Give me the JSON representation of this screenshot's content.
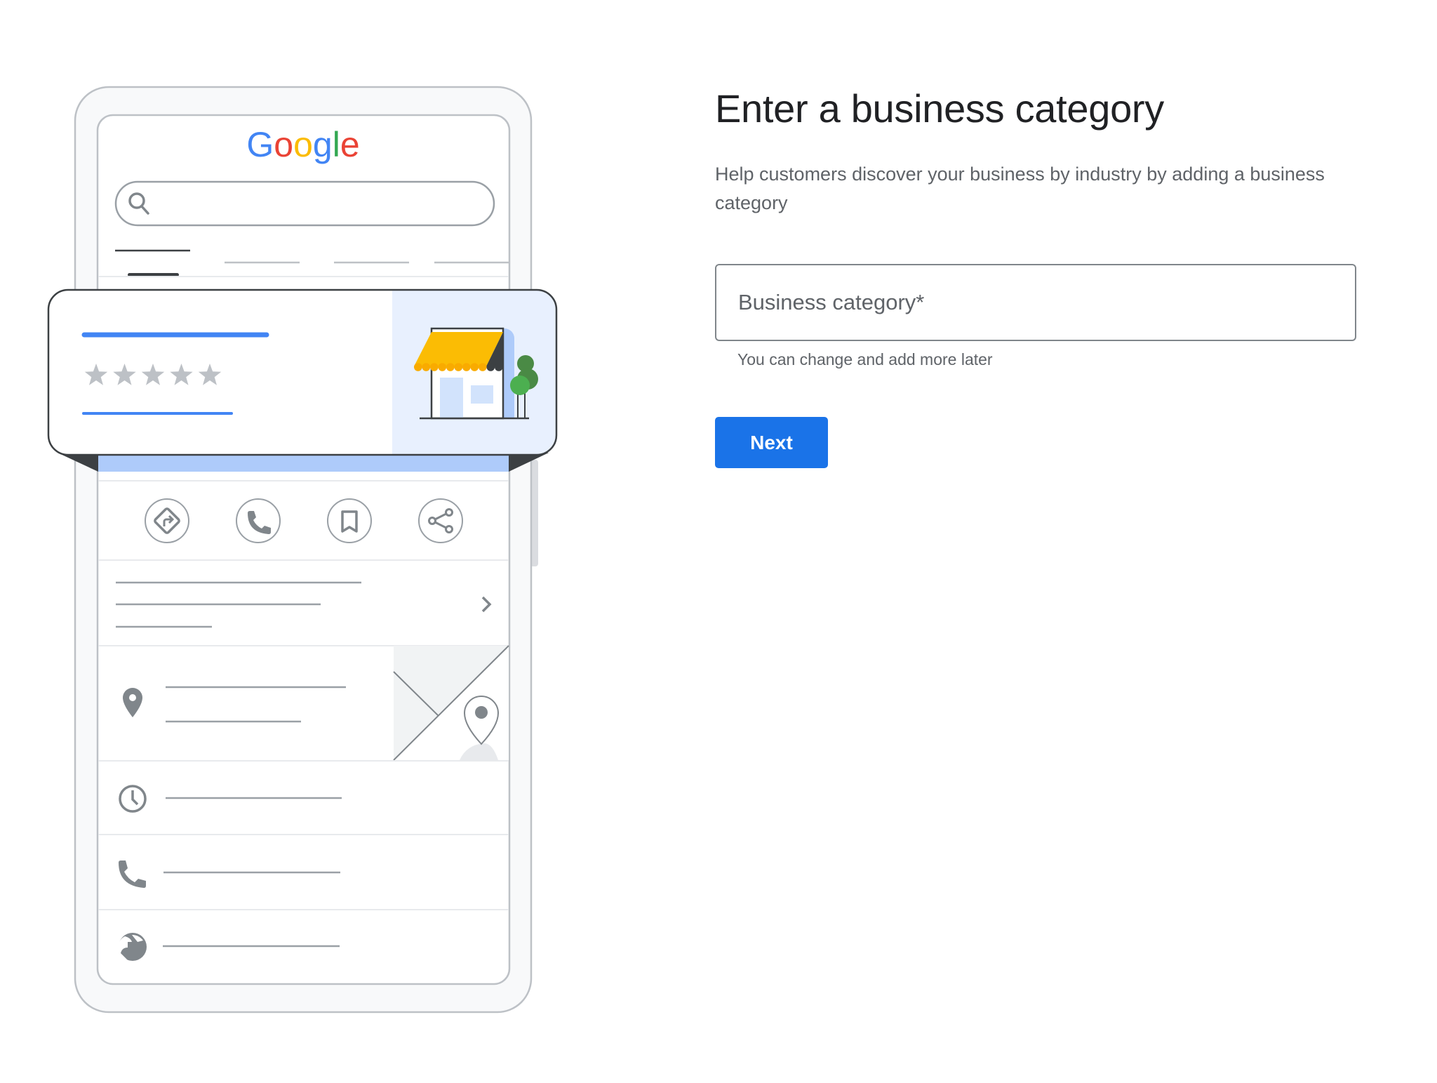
{
  "illustration": {
    "logo_text": "Google",
    "logo_colors": [
      "#4285f4",
      "#ea4335",
      "#fbbc04",
      "#4285f4",
      "#34a853",
      "#ea4335"
    ],
    "rating_stars": 5,
    "icons": {
      "search": "search-icon",
      "actions": [
        "directions-icon",
        "phone-icon",
        "bookmark-icon",
        "share-icon"
      ],
      "chevron": "chevron-right-icon",
      "location": "location-pin-icon",
      "hours": "clock-icon",
      "call": "phone-icon",
      "website": "globe-icon"
    }
  },
  "form": {
    "title": "Enter a business category",
    "description": "Help customers discover your business by industry by adding a business category",
    "category_input": {
      "placeholder": "Business category*",
      "value": ""
    },
    "helper_text": "You can change and add more later",
    "next_label": "Next"
  },
  "colors": {
    "accent": "#1a73e8",
    "title": "#202124",
    "secondary_text": "#5f6368"
  }
}
